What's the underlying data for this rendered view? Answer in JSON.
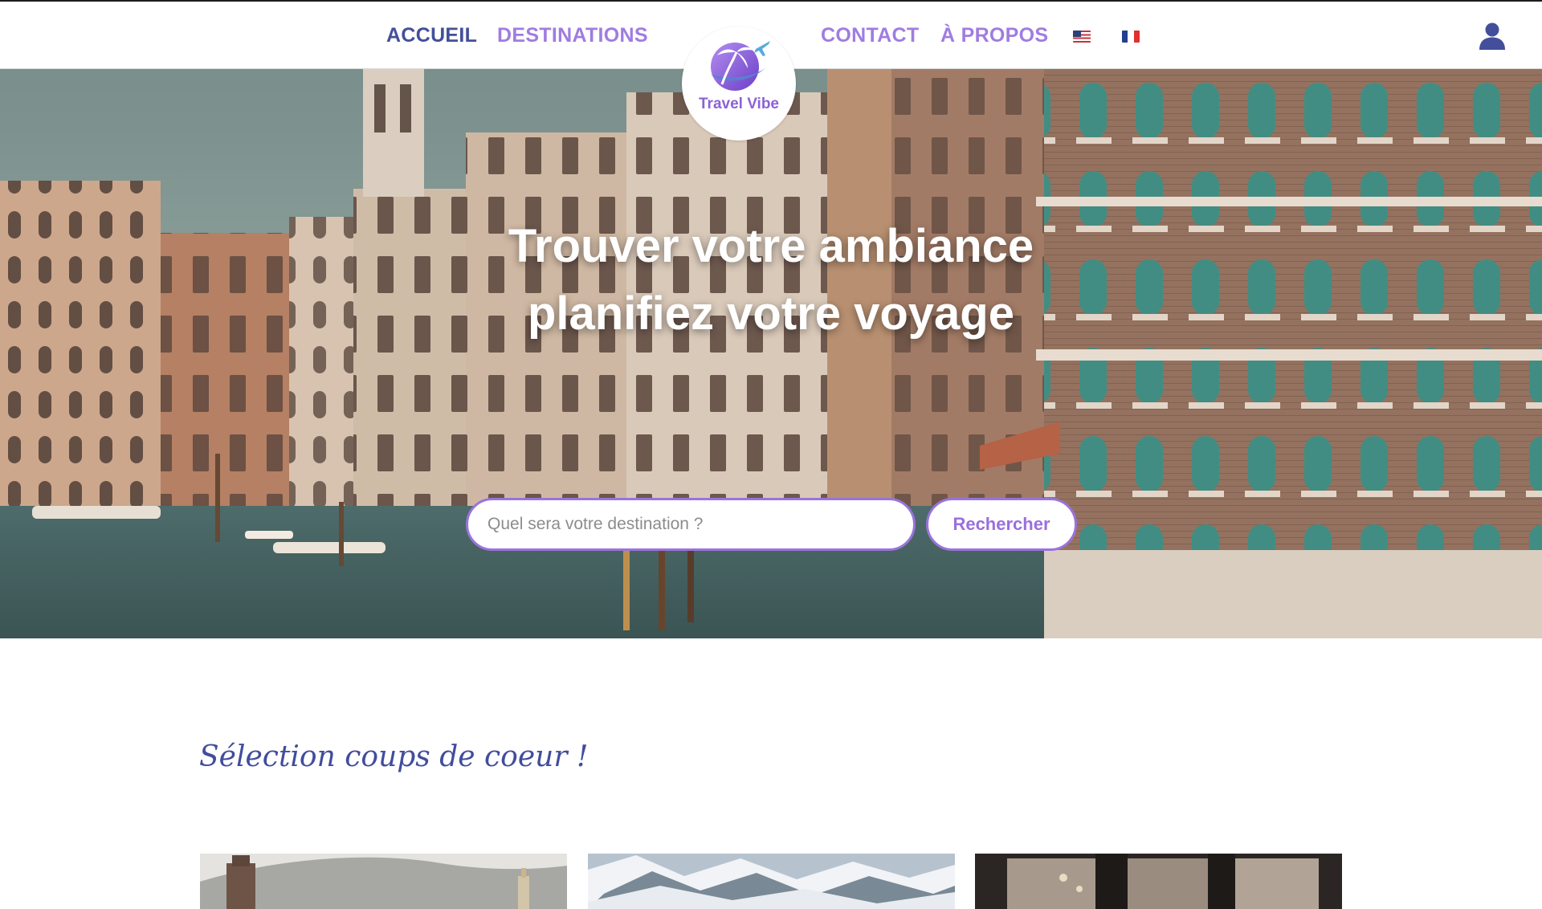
{
  "nav": {
    "accueil": "ACCUEIL",
    "destinations": "DESTINATIONS",
    "contact": "CONTACT",
    "a_propos": "À PROPOS",
    "flags": [
      "flag-us-icon",
      "flag-fr-icon"
    ],
    "user_icon": "user-icon"
  },
  "logo": {
    "text": "Travel Vibe",
    "icon": "palm-tree-airplane-icon"
  },
  "hero": {
    "title_line1": "Trouver votre ambiance",
    "title_line2": "planifiez votre voyage",
    "search_placeholder": "Quel sera votre destination ?",
    "search_button": "Rechercher"
  },
  "selection": {
    "title": "Sélection coups de coeur !",
    "cards": [
      "card-tower-city-image",
      "card-snowy-mountains-image",
      "card-interior-image"
    ]
  },
  "colors": {
    "nav_active": "#434f9a",
    "nav_link": "#a07ce0",
    "accent_purple": "#9a73dc",
    "section_title": "#414d9c"
  }
}
